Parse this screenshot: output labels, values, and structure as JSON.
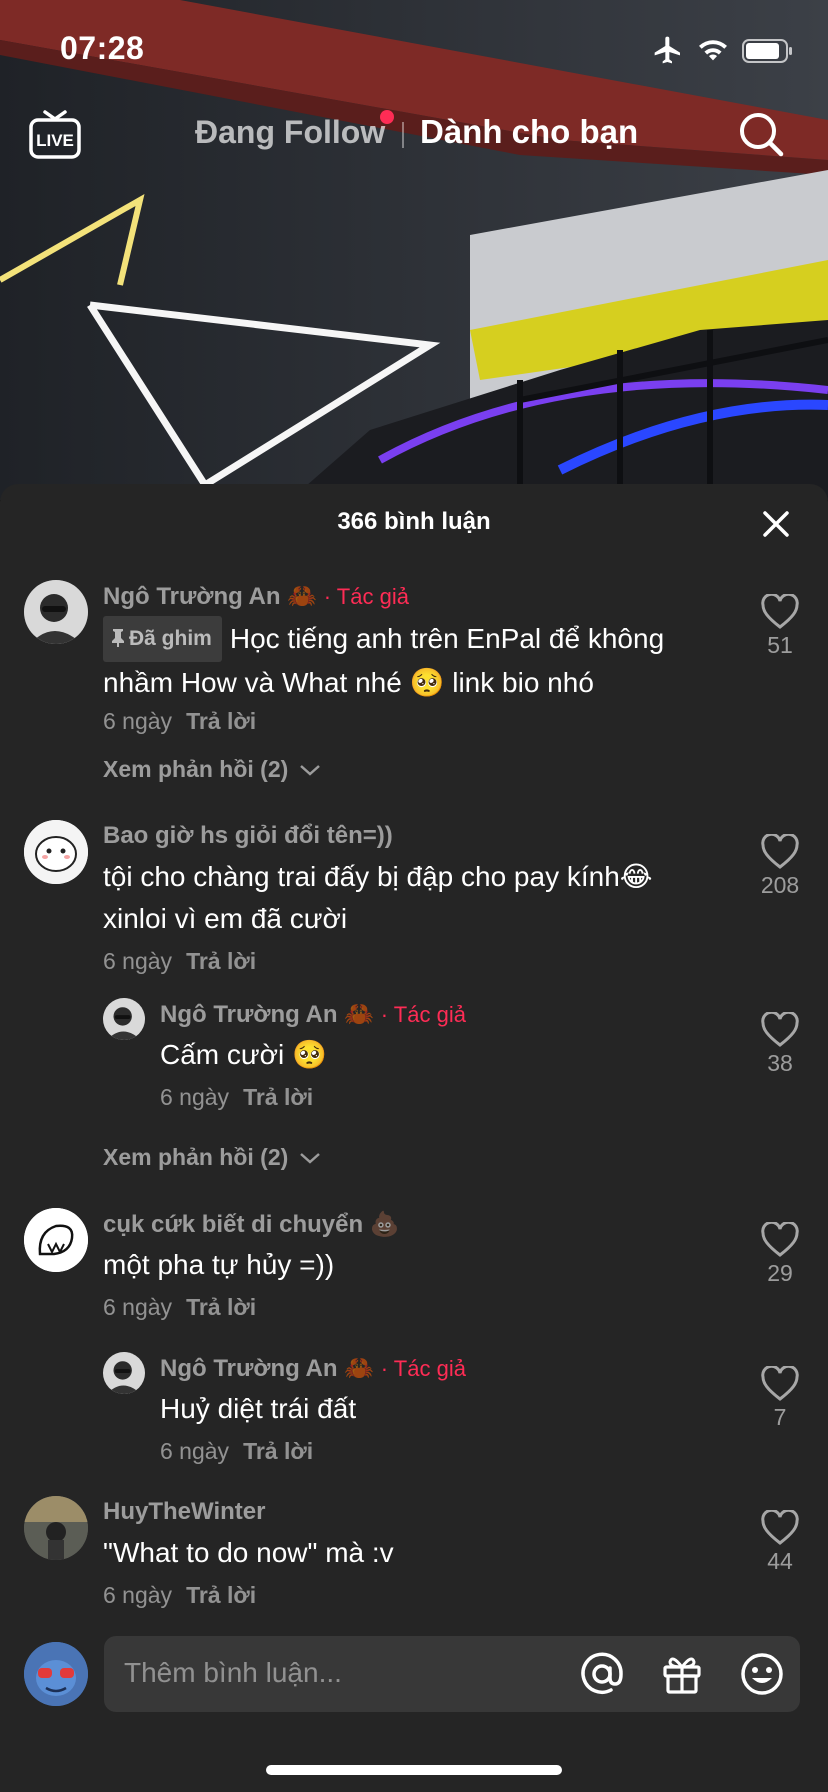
{
  "status_bar": {
    "time": "07:28"
  },
  "top_nav": {
    "live_label": "LIVE",
    "tab_following": "Đang Follow",
    "tab_for_you": "Dành cho bạn"
  },
  "comments_sheet": {
    "title": "366 bình luận",
    "comments": [
      {
        "username": "Ngô Trường An 🦀",
        "author_tag": "· Tác giả",
        "pinned_label": "Đã ghim",
        "text": "Học tiếng anh trên EnPal để không nhầm How và What nhé 🥺 link bio nhó",
        "time": "6 ngày",
        "reply_label": "Trả lời",
        "likes": "51",
        "view_replies": "Xem phản hồi (2)"
      },
      {
        "username": "Bao giờ hs giỏi đổi tên=))",
        "text": "tội cho chàng trai đấy bị đập cho pay kính😂 xinloi vì em đã cười",
        "time": "6 ngày",
        "reply_label": "Trả lời",
        "likes": "208",
        "reply": {
          "username": "Ngô Trường An 🦀",
          "author_tag": "· Tác giả",
          "text": "Cấm cười 🥺",
          "time": "6 ngày",
          "reply_label": "Trả lời",
          "likes": "38"
        },
        "view_replies": "Xem phản hồi (2)"
      },
      {
        "username": "cụk cứk biết di chuyển 💩",
        "text": "một pha tự hủy =))",
        "time": "6 ngày",
        "reply_label": "Trả lời",
        "likes": "29",
        "reply": {
          "username": "Ngô Trường An 🦀",
          "author_tag": "· Tác giả",
          "text": "Huỷ diệt trái đất",
          "time": "6 ngày",
          "reply_label": "Trả lời",
          "likes": "7"
        }
      },
      {
        "username": "HuyTheWinter",
        "text": "\"What to do now\" mà :v",
        "time": "6 ngày",
        "reply_label": "Trả lời",
        "likes": "44"
      }
    ]
  },
  "input_bar": {
    "placeholder": "Thêm bình luận..."
  },
  "colors": {
    "accent": "#fe2c55",
    "sheet_bg": "#252525",
    "input_bg": "#383838"
  },
  "icons": [
    "live-icon",
    "search-icon",
    "close-icon",
    "heart-icon",
    "pin-icon",
    "chevron-down-icon",
    "at-icon",
    "gift-icon",
    "emoji-icon",
    "airplane-icon",
    "wifi-icon",
    "battery-icon"
  ]
}
